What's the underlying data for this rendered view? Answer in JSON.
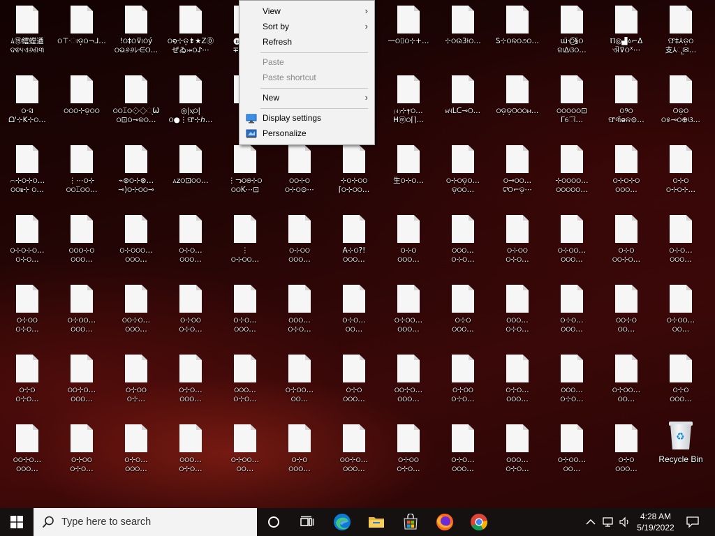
{
  "desktop": {
    "icons": [
      "ﾑ⑲繧螳遒\nଦଵ୳ଏ୬ଣ୩",
      "ଠ⊤·ାଡ଼ଠ¬⅃…",
      "!ଠ‡ଠ⊽୲ଠý\nଠଭ୬୬ﾚ⋲୦…",
      "ଠ໑⊹ଡ଼⇟★Z⓪\nぜゐ⤖ଠ𐰀⋯",
      "🅑⊤ଠଠ\n∓⟛ଠ⋲",
      "",
      "",
      "一ଠ⌷ଠ⊹+…",
      "⊹ଠଉ3⍿ଠ…",
      "Ꮪ⊹ଠଳଠ૭ଠ…",
      "ա̈·ଠ⃝§ଠ\nଜା∆ଓଠ…",
      "Ⲡ◎▟⟑⌐ᐃ\nଐ⊽ଠᕽ⋯",
      "ଫ‡⅄ଡ଼ଠ\n支⅄ୂ✉…",
      "ଠ·ସ\nᗝ'⊹K⊹ଠ…",
      "ଠଠଠ⊹ଡ଼ଠଠ",
      "ଠଠ⌶ଠ⟐◇୍Ѿ\nଠ⊡ଠ⊸ଳଠ…",
      "◎|ⲭଠ|\nଠ●⋮ଫ⊹ℎ…",
      "",
      "",
      "",
      "⑷⊹ⲯଠ…\nᕼⓜଠ⌈⌉…",
      "ⲏ୳ᒪᑕ⊸୦…",
      "ଠଡ଼ଡ଼୦ଠଠⲙ…",
      "ଠଠଠଠଠ⊡ᒥୌ…",
      "ଠ୨ଠ\nଫ୩ଁⱺଳ⊙…",
      "୦ଡ଼ଠ\nଠ୫⊸ଠ⊕ଓ…",
      "⌒⊹ଠ⊹ଠ…\nଠଠⲃ⊹ ଠ…",
      "⋮⋯ଠ⊹\nଠଠ⌶ଠଠ…",
      "⌁⊛ଠ⊹⊗…\n⊸)ଠ⊹ଠଠ⊸",
      "ⲁzଠ⊡ଠଠ…",
      "⋮ᓓଠଞ⊹ଠ\nଠଠK⋯⊡",
      "ଠଠ⊹ଠ\nଠ⊹ଠ⊙⋯",
      "⊹ଠ⊹ଠଠ\n⌈ଠ⊹ଠଠ…",
      "生ଠ⊹ଠ…",
      "ଠ⊹ଠଡ଼ଠ…\nଡ଼ଠଠ…",
      "ଠ⊸ଠଠ…\nଟ୦⌐ଡ଼⋯",
      "⊹ଠଠଠଠ…\nଠଠଠଠଠ…",
      "ଠ⊹ଠ⊹ଠ\nଠଠଠ…",
      "ଠ⊹ଠ\nଠ⊹ଠ⊹…",
      "ଠ⊹ଠ⊹ଠ…\nଠ⊹ଠ…",
      "ଠଠଠ⊹ଠ\nଠଠଠ…",
      "ଠ⊹ଠଠଠ…\nଠଠଠ…",
      "ଠ⊹ଠ…\nଠଠଠ…",
      "⋮\nଠ⊹ଠଠ…",
      "ଠ⊹ଠଠ\nଠଠଠ…",
      "A⊹ଠ?!\nଠଠଠ…",
      "ଠ⊹ଠ\nଠଠଠ…",
      "ଠଠଠ…\nଠ⊹ଠ…",
      "ଠ⊹ଠଠ\nଠ⊹ଠ…",
      "ଠ⊹ଠଠ…\nଠଠଠ…",
      "ଠ⊹ଠ\nଠଠ⊹ଠ…",
      "ଠ⊹ଠ…\nଠଠଠ…",
      "ଠ⊹ଠଠ\nଠ⊹ଠ…",
      "ଠ⊹ଠଠ…\nଠଠଠ…",
      "ଠଠ⊹ଠ…\nଠଠଠ…",
      "ଠ⊹ଠଠ\nଠ⊹ଠ…",
      "ଠ⊹ଠ…\nଠଠଠ…",
      "ଠଠଠ…\nଠ⊹ଠ…",
      "ଠ⊹ଠ…\nଠଠ…",
      "ଠ⊹ଠଠ…\nଠଠଠ…",
      "ଠ⊹ଠ\nଠଠଠ…",
      "ଠଠଠ…\nଠ⊹ଠ…",
      "ଠ⊹ଠ…\nଠଠଠ…",
      "ଠଠ⊹ଠ\nଠଠ…",
      "ଠ⊹ଠଠ…\nଠଠ…",
      "ଠ⊹ଠ\nଠ⊹ଠ…",
      "ଠଠ⊹ଠ…\nଠଠଠ…",
      "ଠ⊹ଠଠ\nଠ⊹…",
      "ଠ⊹ଠ…\nଠଠଠ…",
      "ଠଠଠ…\nଠ⊹ଠ…",
      "ଠ⊹ଠଠ…\nଠଠ…",
      "ଠ⊹ଠ\nଠଠଠ…",
      "ଠଠ⊹ଠ…\nଠଠଠ…",
      "ଠ⊹ଠଠ\nଠ⊹ଠ…",
      "ଠ⊹ଠ…\nଠଠଠ…",
      "ଠଠଠ…\nଠ⊹ଠ…",
      "ଠ⊹ଠଠ…\nଠଠ…",
      "ଠ⊹ଠ\nଠଠଠ…",
      "ଠଠ⊹ଠ…\nଠଠଠ…",
      "ଠ⊹ଠଠ\nଠ⊹ଠ…",
      "ଠ⊹ଠ…\nଠଠଠ…",
      "ଠଠଠ…\nଠ⊹ଠ…",
      "ଠ⊹ଠଠ…\nଠଠ…",
      "ଠ⊹ଠ\nଠଠଠ…",
      "ଠଠ⊹ଠ…\nଠଠଠ…",
      "ଠ⊹ଠଠ\nଠ⊹ଠ…",
      "ଠ⊹ଠ…\nଠଠଠ…",
      "ଠଠଠ…\nଠ⊹ଠ…",
      "ଠ⊹ଠଠ…\nଠଠ…",
      "ଠ⊹ଠ\nଠଠଠ…"
    ],
    "recycle_bin_label": "Recycle Bin"
  },
  "context_menu": {
    "view": "View",
    "sort_by": "Sort by",
    "refresh": "Refresh",
    "paste": "Paste",
    "paste_shortcut": "Paste shortcut",
    "new": "New",
    "display_settings": "Display settings",
    "personalize": "Personalize"
  },
  "taskbar": {
    "search_placeholder": "Type here to search",
    "time": "4:28 AM",
    "date": "5/19/2022",
    "pinned": [
      "windows-icon",
      "cortana-icon",
      "task-view-icon",
      "edge-icon",
      "file-explorer-icon",
      "store-icon",
      "firefox-icon",
      "chrome-icon"
    ]
  },
  "colors": {
    "taskbar_bg": "#141110",
    "menu_bg": "#f2f2f2",
    "desktop_bg": "#2a0505"
  }
}
